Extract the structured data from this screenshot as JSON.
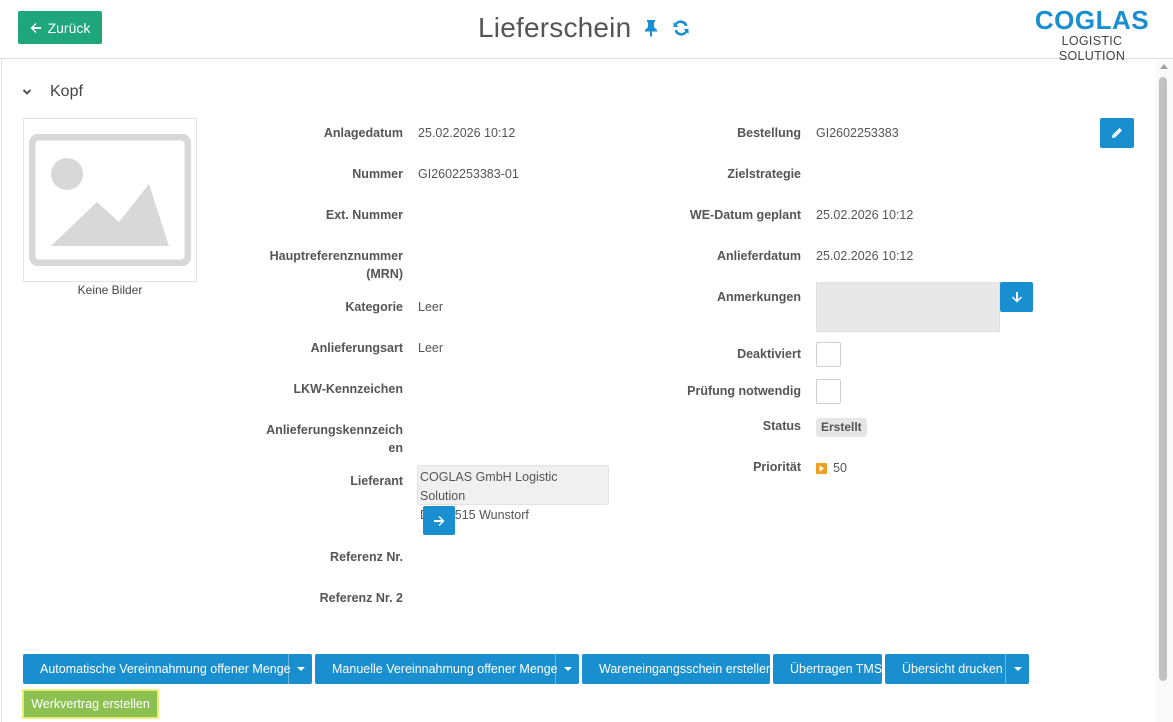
{
  "header": {
    "back_label": "Zurück",
    "title": "Lieferschein",
    "logo_brand": "COGLAS",
    "logo_sub": "LOGISTIC SOLUTION"
  },
  "section": {
    "title": "Kopf"
  },
  "image": {
    "caption": "Keine Bilder"
  },
  "left_fields": {
    "anlagedatum": {
      "label": "Anlagedatum",
      "value": "25.02.2026 10:12"
    },
    "nummer": {
      "label": "Nummer",
      "value": "GI2602253383-01"
    },
    "ext_nummer": {
      "label": "Ext. Nummer",
      "value": ""
    },
    "hauptreferenz": {
      "label_line1": "Hauptreferenznummer",
      "label_line2": "(MRN)",
      "value": ""
    },
    "kategorie": {
      "label": "Kategorie",
      "value": "Leer"
    },
    "anlieferungsart": {
      "label": "Anlieferungsart",
      "value": "Leer"
    },
    "lkw": {
      "label": "LKW-Kennzeichen",
      "value": ""
    },
    "anlieferungskennzeichen": {
      "label_line1": "Anlieferungskennzeich",
      "label_line2": "en",
      "value": ""
    },
    "lieferant": {
      "label": "Lieferant",
      "line1": "COGLAS GmbH Logistic Solution",
      "line2": "DE 31515 Wunstorf"
    },
    "referenz": {
      "label": "Referenz Nr.",
      "value": ""
    },
    "referenz2": {
      "label": "Referenz Nr. 2",
      "value": ""
    }
  },
  "right_fields": {
    "bestellung": {
      "label": "Bestellung",
      "value": "GI2602253383"
    },
    "zielstrategie": {
      "label": "Zielstrategie",
      "value": ""
    },
    "we_datum": {
      "label": "WE-Datum geplant",
      "value": "25.02.2026 10:12"
    },
    "anlieferdatum": {
      "label": "Anlieferdatum",
      "value": "25.02.2026 10:12"
    },
    "anmerkungen": {
      "label": "Anmerkungen",
      "value": ""
    },
    "deaktiviert": {
      "label": "Deaktiviert",
      "checked": false
    },
    "pruefung": {
      "label": "Prüfung notwendig",
      "checked": false
    },
    "status": {
      "label": "Status",
      "value": "Erstellt"
    },
    "prioritaet": {
      "label": "Priorität",
      "value": "50"
    }
  },
  "actions": {
    "auto": "Automatische Vereinnahmung offener Menge",
    "manual": "Manuelle Vereinnahmung offener Menge",
    "we_schein": "Wareneingangsschein erstellen",
    "tms": "Übertragen TMS",
    "print": "Übersicht drucken",
    "werkvertrag": "Werkvertrag erstellen"
  },
  "colors": {
    "primary": "#1a8fd0",
    "back_button": "#1fa67a",
    "green_button": "#8cc152",
    "priority": "#f0a020"
  },
  "icons": {
    "back": "arrow-left-icon",
    "pin": "pin-icon",
    "refresh": "refresh-icon",
    "collapse": "chevron-down-icon",
    "edit": "pencil-icon",
    "supplier_open": "arrow-right-icon",
    "notes_expand": "arrow-down-icon",
    "image_placeholder": "image-placeholder-icon"
  }
}
